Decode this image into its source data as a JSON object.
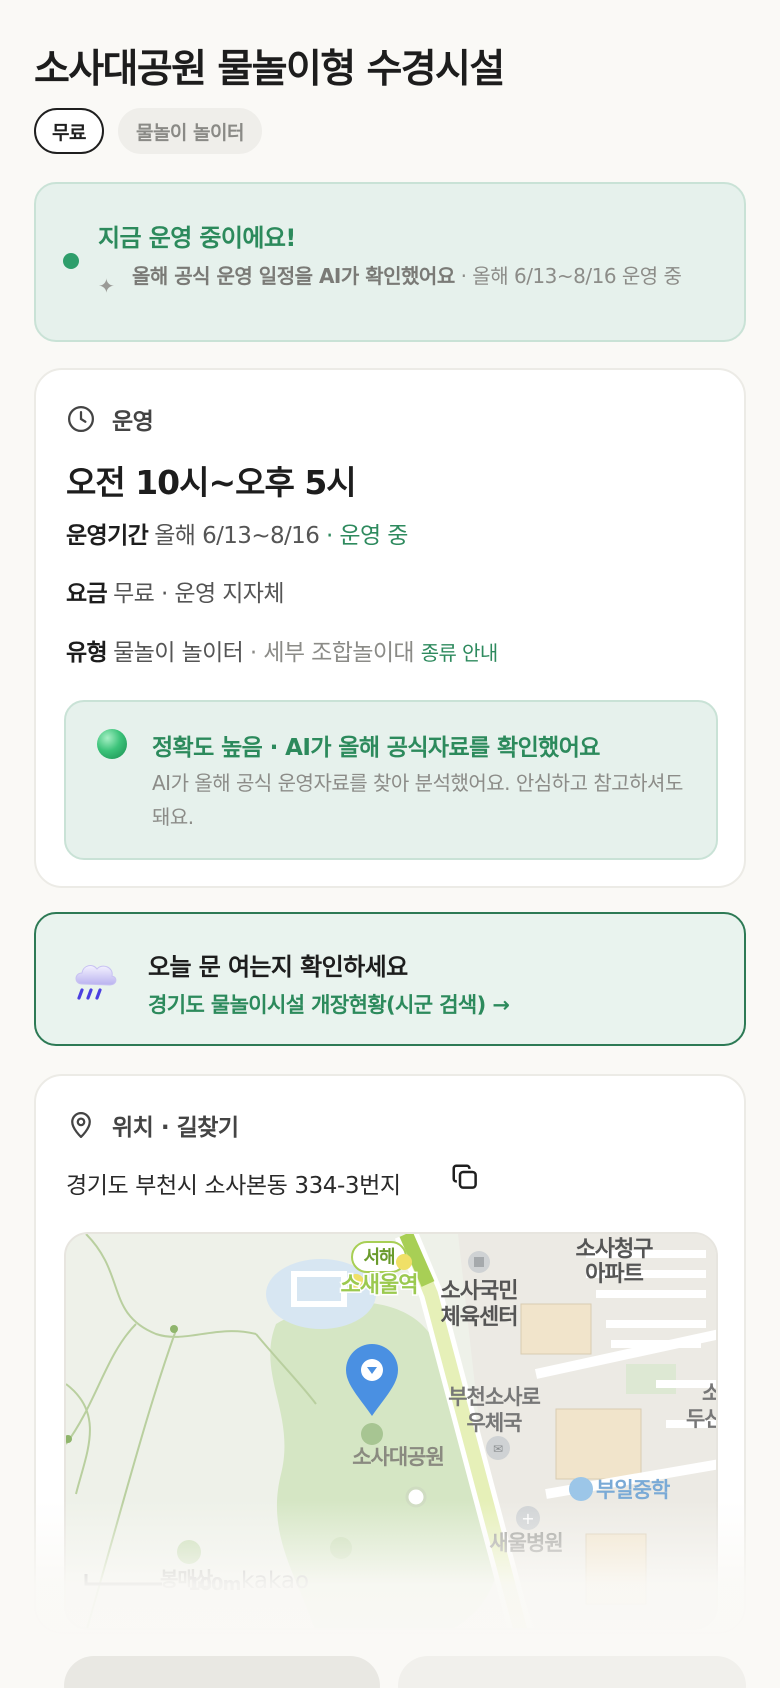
{
  "page": {
    "title": "소사대공원 물놀이형 수경시설",
    "chips": [
      "무료",
      "물놀이 놀이터"
    ]
  },
  "status": {
    "title": "지금 운영 중이에요!",
    "desc_bold": "올해 공식 운영 일정을 AI가 확인했어요",
    "desc_rest": " · 올해 6/13~8/16 운영 중",
    "dot_color": "#2e9e6b"
  },
  "operation": {
    "section_label": "운영",
    "hours": "오전 10시~오후 5시",
    "period_label": "운영기간",
    "period_value": "올해 6/13~8/16",
    "period_status": " · 운영 중",
    "fee_label": "요금",
    "fee_value": "무료 · 운영 지자체",
    "type_label": "유형",
    "type_value": "물놀이 놀이터",
    "type_detail": " · 세부 조합놀이대",
    "type_link": "종류 안내",
    "accuracy_title": "정확도 높음 · AI가 올해 공식자료를 확인했어요",
    "accuracy_desc": "AI가 올해 공식 운영자료를 찾아 분석했어요. 안심하고 참고하셔도 돼요."
  },
  "notice": {
    "title": "오늘 문 여는지 확인하세요",
    "link": "경기도 물놀이시설 개장현황(시군 검색) →"
  },
  "location": {
    "section_label": "위치 · 길찾기",
    "address": "경기도 부천시 소사본동 334-3번지",
    "map": {
      "labels": {
        "park": "소사대공원",
        "station_line": "서해",
        "station": "소새울역",
        "sports": "소사국민",
        "sports2": "체육센터",
        "apt": "소사청구",
        "apt2": "아파트",
        "post": "부천소사로",
        "post2": "우체국",
        "school": "부일중학",
        "hospital": "새울병원",
        "edge1": "소",
        "edge2": "두산",
        "mountain": "봉매산",
        "scale": "100m",
        "brand": "kakao"
      }
    }
  }
}
